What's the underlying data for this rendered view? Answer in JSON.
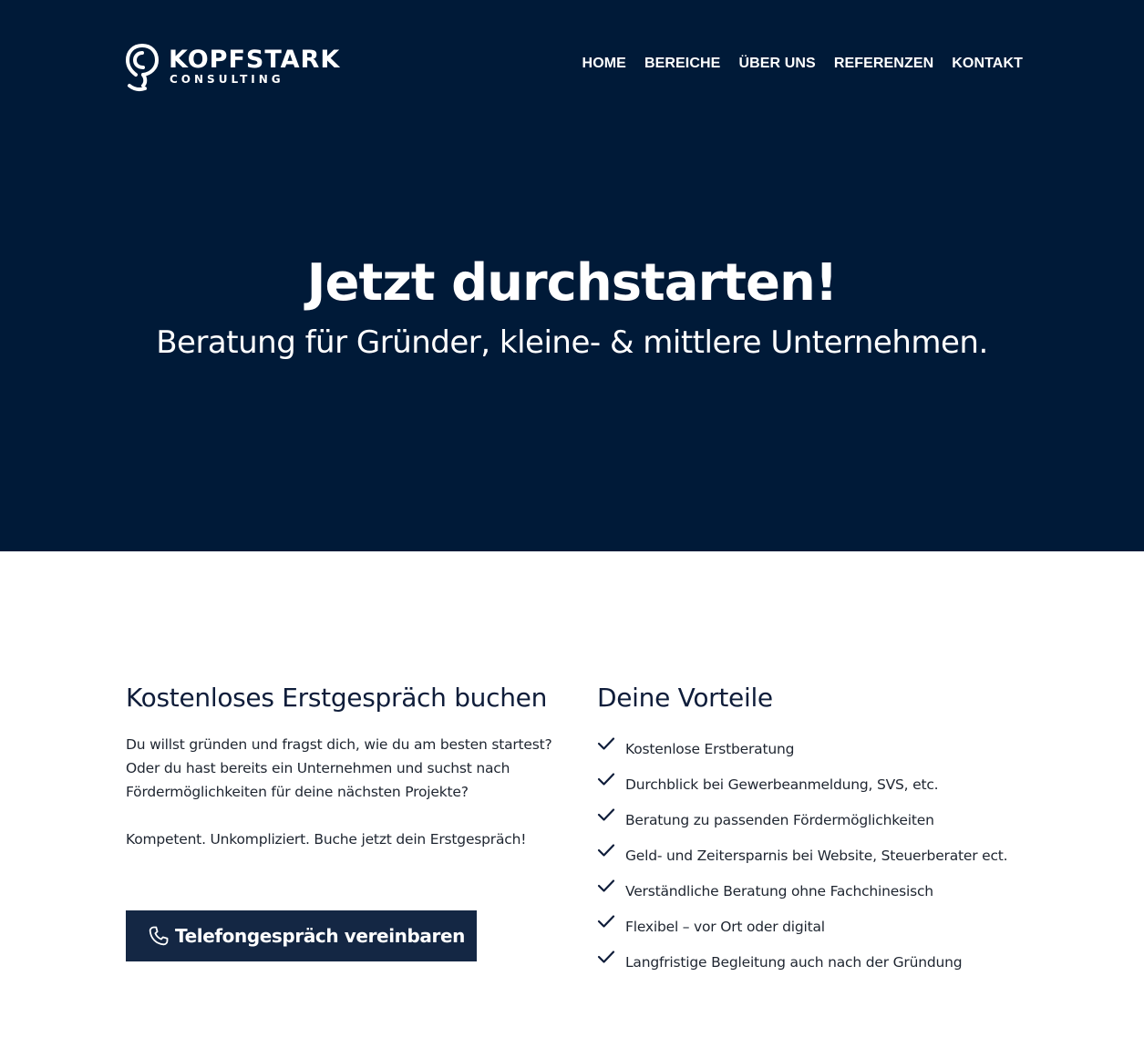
{
  "brand": {
    "name": "KOPFSTARK",
    "sub": "CONSULTING",
    "logo_icon": "head-profile-icon"
  },
  "nav": {
    "items": [
      {
        "label": "HOME"
      },
      {
        "label": "BEREICHE"
      },
      {
        "label": "ÜBER UNS"
      },
      {
        "label": "REFERENZEN"
      },
      {
        "label": "KONTAKT"
      }
    ]
  },
  "hero": {
    "title": "Jetzt durchstarten!",
    "subtitle": "Beratung für Gründer, kleine- & mittlere Unternehmen."
  },
  "booking": {
    "title": "Kostenloses Erstgespräch buchen",
    "text": "Du willst gründen und fragst dich, wie du am besten startest? Oder du hast bereits ein Unternehmen und suchst nach Fördermöglichkeiten für deine nächsten Projekte?",
    "text2": "Kompetent. Unkompliziert. Buche jetzt dein Erstgespräch!",
    "cta_label": "Telefongespräch vereinbaren",
    "cta_icon": "phone-icon"
  },
  "benefits": {
    "title": "Deine Vorteile",
    "icon": "check-icon",
    "items": [
      "Kostenlose Erstberatung",
      "Durchblick bei Gewerbeanmeldung, SVS, etc.",
      "Beratung zu passenden Fördermöglichkeiten",
      "Geld- und Zeitersparnis bei Website, Steuerberater ect.",
      "Verständliche Beratung ohne Fachchinesisch",
      "Flexibel – vor Ort oder digital",
      "Langfristige Begleitung auch nach der Gründung"
    ]
  },
  "colors": {
    "hero_bg": "#001a38",
    "button_bg": "#142744",
    "heading": "#0f1d3a",
    "text": "#1e2530"
  }
}
